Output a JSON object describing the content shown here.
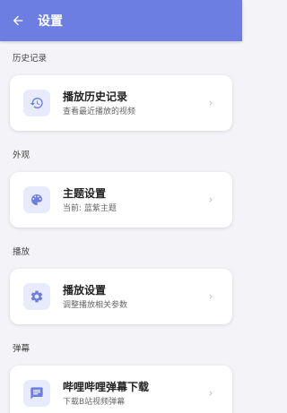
{
  "appbar": {
    "title": "设置"
  },
  "sections": [
    {
      "label": "历史记录",
      "card": {
        "icon": "history-icon",
        "title": "播放历史记录",
        "subtitle": "查看最近播放的视频"
      }
    },
    {
      "label": "外观",
      "card": {
        "icon": "palette-icon",
        "title": "主题设置",
        "subtitle": "当前: 蓝紫主题"
      }
    },
    {
      "label": "播放",
      "card": {
        "icon": "gear-icon",
        "title": "播放设置",
        "subtitle": "调整播放相关参数"
      }
    },
    {
      "label": "弹幕",
      "card": {
        "icon": "danmaku-icon",
        "title": "哔哩哔哩弹幕下载",
        "subtitle": "下载B站视频弹幕"
      }
    }
  ],
  "colors": {
    "accent": "#6c7ee1",
    "icon_bg": "#e8ebfb",
    "background": "#f4f4f8"
  }
}
